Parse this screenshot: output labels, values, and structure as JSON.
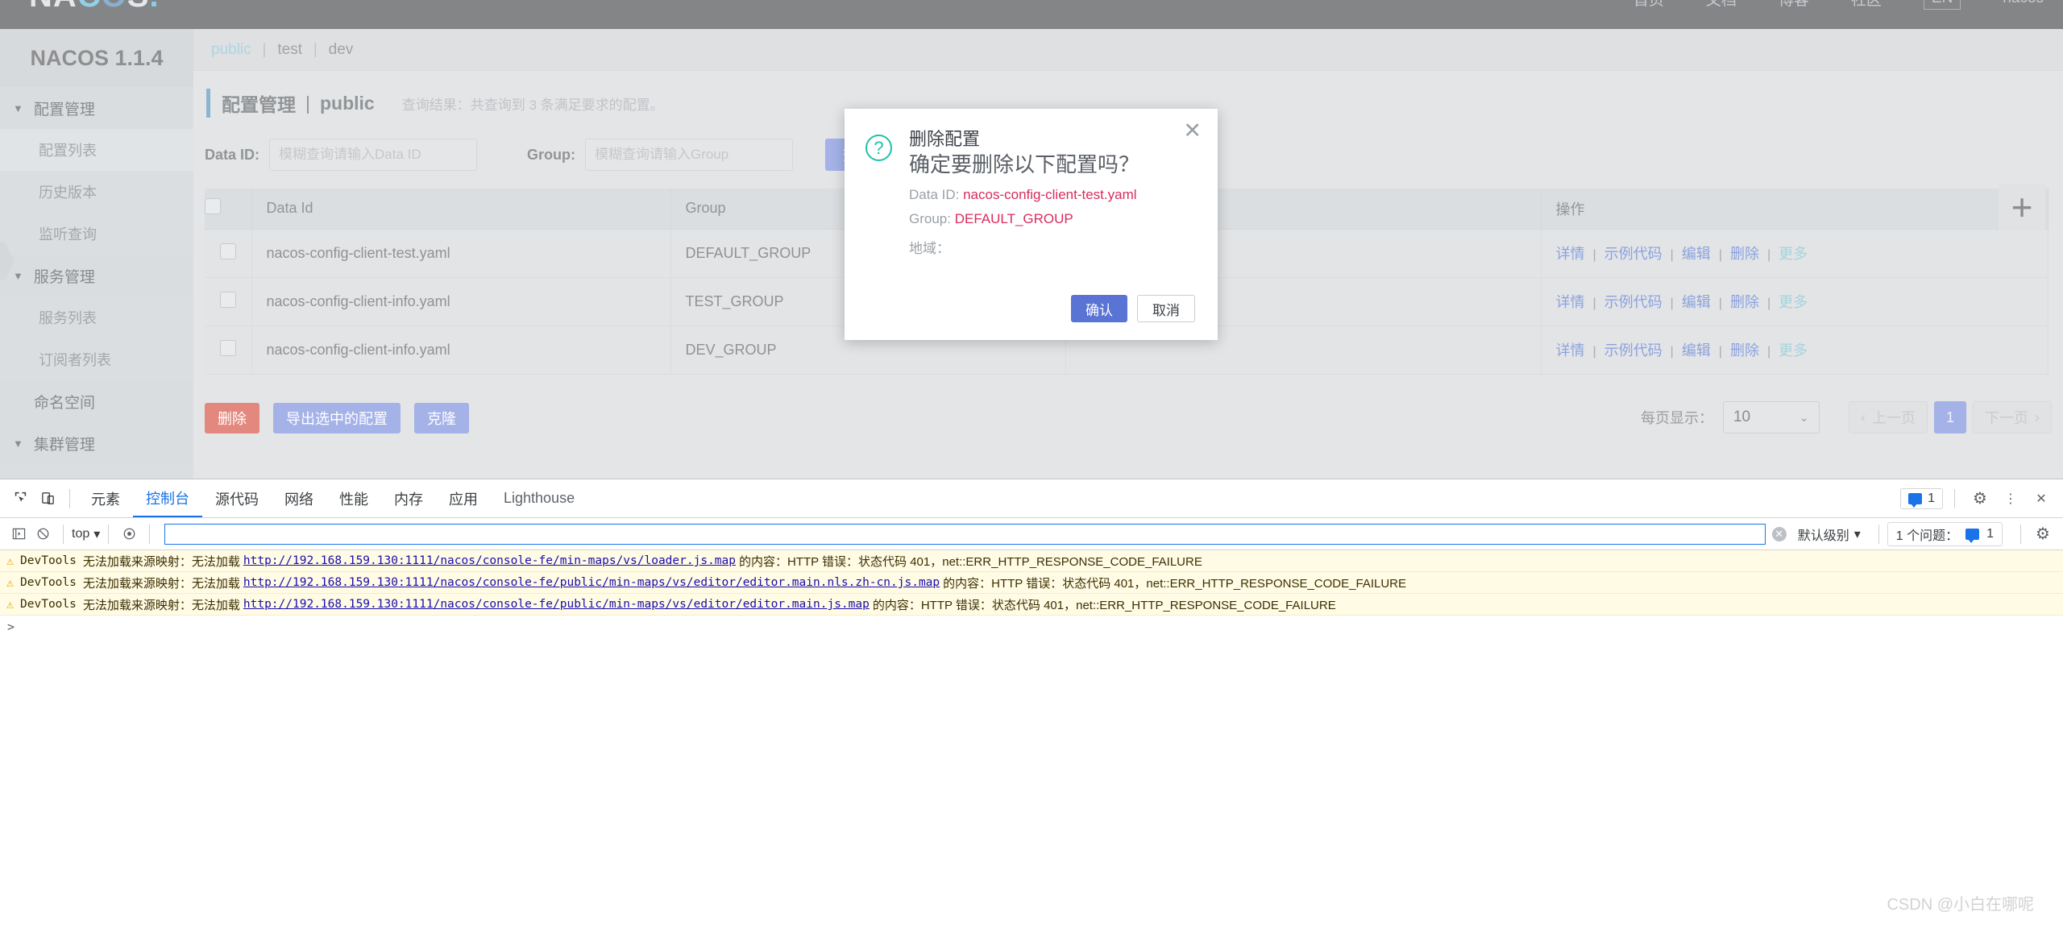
{
  "topnav": {
    "logo": {
      "part1": "NA",
      "part2": "C",
      "part3": "O",
      "part4": "S",
      "dot": "."
    },
    "items": [
      "首页",
      "文档",
      "博客",
      "社区"
    ],
    "lang": "EN",
    "user": "nacos"
  },
  "sidebar": {
    "title": "NACOS 1.1.4",
    "groups": [
      {
        "label": "配置管理",
        "items": [
          "配置列表",
          "历史版本",
          "监听查询"
        ]
      },
      {
        "label": "服务管理",
        "items": [
          "服务列表",
          "订阅者列表"
        ]
      }
    ],
    "namespace_label": "命名空间",
    "cluster_label": "集群管理",
    "active_item": "配置列表"
  },
  "namespaces": {
    "active": "public",
    "others": [
      "test",
      "dev"
    ],
    "sep": "|"
  },
  "page": {
    "title": "配置管理",
    "title_sep": "|",
    "namespace": "public",
    "result_text": "查询结果：共查询到 3 条满足要求的配置。"
  },
  "filters": {
    "dataid_label": "Data ID:",
    "dataid_placeholder": "模糊查询请输入Data ID",
    "dataid_value": "",
    "group_label": "Group:",
    "group_placeholder": "模糊查询请输入Group",
    "group_value": "",
    "query_button": "查询",
    "add_icon": "plus-icon"
  },
  "table": {
    "headers": [
      "",
      "Data Id",
      "Group",
      "",
      "操作"
    ],
    "rows": [
      {
        "data_id": "nacos-config-client-test.yaml",
        "group": "DEFAULT_GROUP",
        "mid": "",
        "ops": [
          "详情",
          "示例代码",
          "编辑",
          "删除",
          "更多"
        ]
      },
      {
        "data_id": "nacos-config-client-info.yaml",
        "group": "TEST_GROUP",
        "mid": "",
        "ops": [
          "详情",
          "示例代码",
          "编辑",
          "删除",
          "更多"
        ]
      },
      {
        "data_id": "nacos-config-client-info.yaml",
        "group": "DEV_GROUP",
        "mid": "",
        "ops": [
          "详情",
          "示例代码",
          "编辑",
          "删除",
          "更多"
        ]
      }
    ],
    "op_sep": "|"
  },
  "footer": {
    "delete_button": "删除",
    "export_button": "导出选中的配置",
    "clone_button": "克隆"
  },
  "pagination": {
    "per_page_label": "每页显示：",
    "per_page_value": "10",
    "prev": "上一页",
    "current": "1",
    "next": "下一页"
  },
  "modal": {
    "icon": "question-circle-icon",
    "close_icon": "close-icon",
    "title": "删除配置",
    "question": "确定要删除以下配置吗？",
    "dataid_label": "Data ID:",
    "dataid_value": "nacos-config-client-test.yaml",
    "group_label": "Group:",
    "group_value": "DEFAULT_GROUP",
    "region_label": "地域：",
    "region_value": "",
    "confirm": "确认",
    "cancel": "取消",
    "accent_color": "#d82b5e",
    "icon_color": "#1ec0a8"
  },
  "devtools": {
    "icons": [
      "inspect-icon",
      "device-toggle-icon"
    ],
    "tabs": [
      "元素",
      "控制台",
      "源代码",
      "网络",
      "性能",
      "内存",
      "应用",
      "Lighthouse"
    ],
    "active_tab": "控制台",
    "issue_count": "1",
    "settings_icon": "gear-icon",
    "more_icon": "kebab-menu-icon",
    "close_icon": "close-icon",
    "console": {
      "sidebar_icon": "panel-toggle-icon",
      "clear_icon": "clear-console-icon",
      "context": "top",
      "eye_icon": "live-expression-icon",
      "filter_value": "",
      "filter_placeholder": "",
      "clear_filter_icon": "clear-icon",
      "level": "默认级别",
      "issues_label": "1 个问题：",
      "issues_count": "1",
      "settings_icon": "gear-icon",
      "prompt": ">"
    },
    "logs": [
      {
        "source": "DevTools",
        "prefix": "无法加载来源映射：无法加载",
        "url": "http://192.168.159.130:1111/nacos/console-fe/min-maps/vs/loader.js.map",
        "suffix": "的内容：HTTP 错误：状态代码 401，net::ERR_HTTP_RESPONSE_CODE_FAILURE"
      },
      {
        "source": "DevTools",
        "prefix": "无法加载来源映射：无法加载",
        "url": "http://192.168.159.130:1111/nacos/console-fe/public/min-maps/vs/editor/editor.main.nls.zh-cn.js.map",
        "suffix": "的内容：HTTP 错误：状态代码 401，net::ERR_HTTP_RESPONSE_CODE_FAILURE"
      },
      {
        "source": "DevTools",
        "prefix": "无法加载来源映射：无法加载",
        "url": "http://192.168.159.130:1111/nacos/console-fe/public/min-maps/vs/editor/editor.main.js.map",
        "suffix": "的内容：HTTP 错误：状态代码 401，net::ERR_HTTP_RESPONSE_CODE_FAILURE"
      }
    ]
  },
  "watermark": "CSDN @小白在哪呢"
}
